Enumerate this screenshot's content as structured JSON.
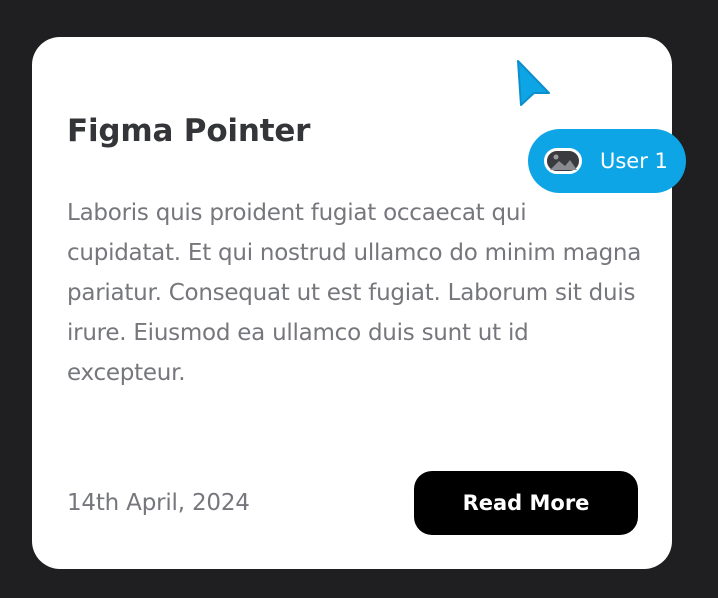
{
  "card": {
    "title": "Figma Pointer",
    "body": "Laboris quis proident fugiat occaecat qui cupidatat. Et qui nostrud ullamco do minim magna pariatur. Consequat ut est fugiat. Laborum sit duis irure. Eiusmod ea ullamco duis sunt ut id excepteur.",
    "date": "14th April, 2024",
    "button_label": "Read More"
  },
  "pointer": {
    "user_label": "User 1",
    "icon": "cursor-arrow-icon",
    "avatar_icon": "image-placeholder-icon",
    "color": "#0ea5e6"
  },
  "colors": {
    "page_background": "#1f1f21",
    "card_background": "#ffffff",
    "title": "#333538",
    "body_text": "#76777c",
    "button_background": "#000000",
    "button_text": "#ffffff"
  }
}
